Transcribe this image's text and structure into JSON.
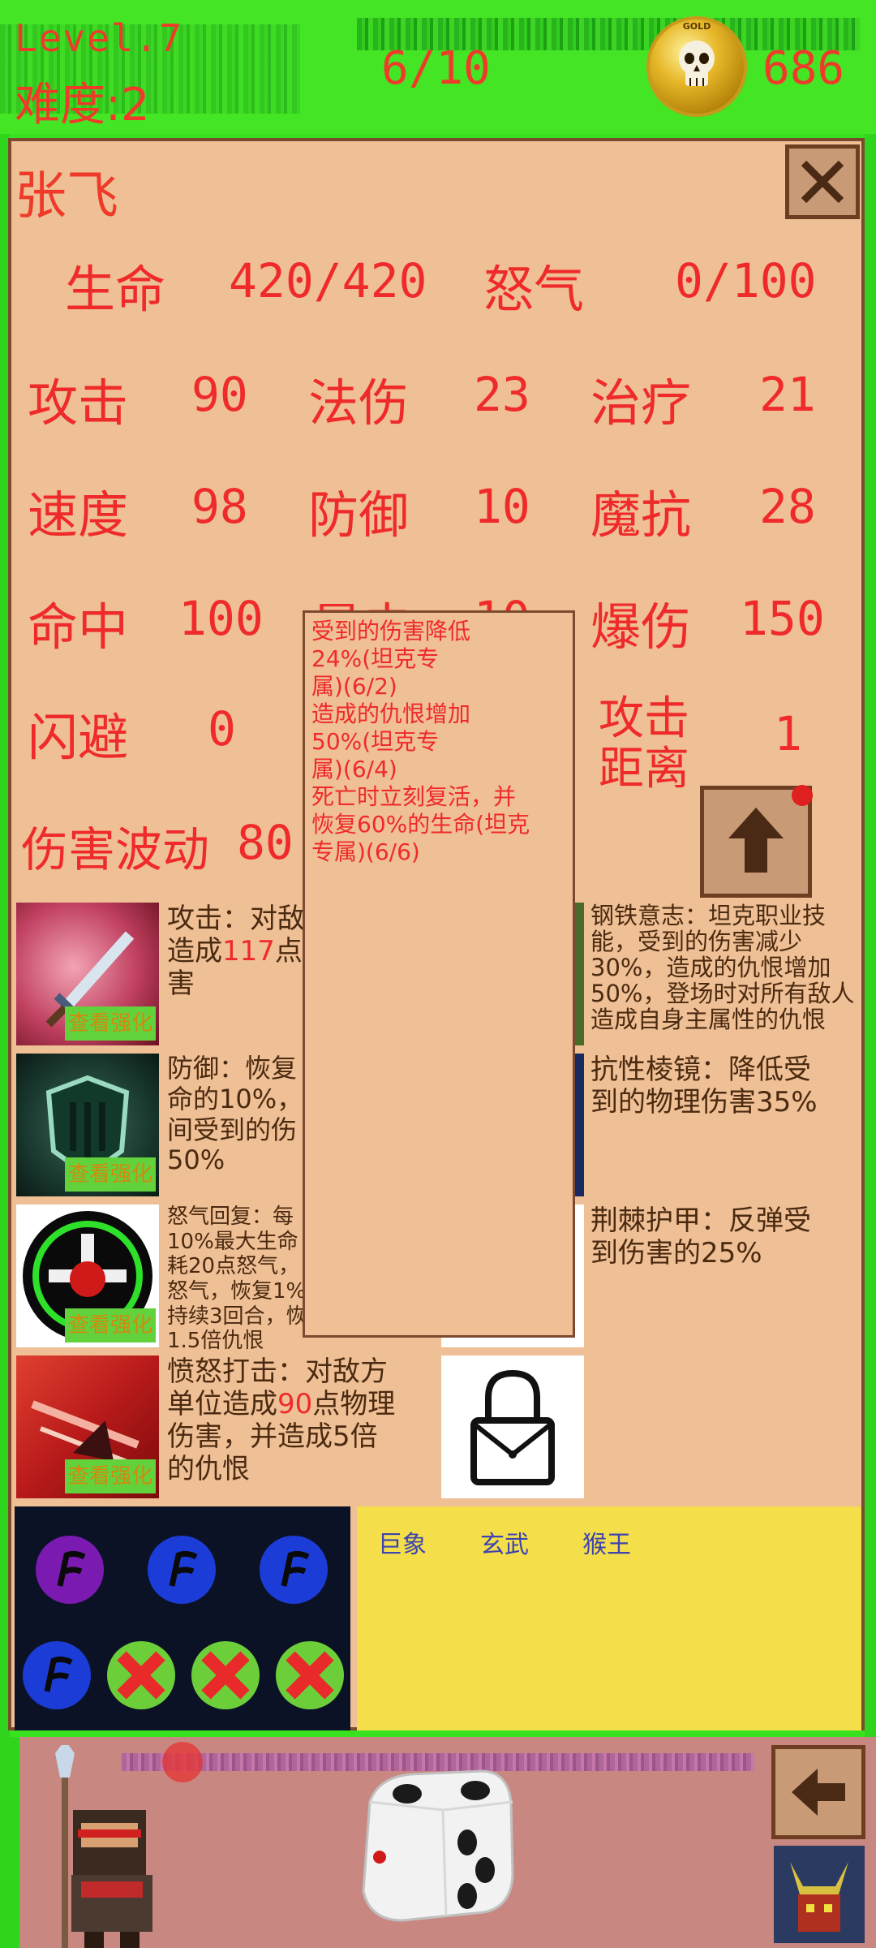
{
  "top": {
    "level": "Level.7",
    "difficulty": "难度:2",
    "progress": "6/10",
    "coin_text": "GOLD",
    "gold": "686"
  },
  "hero": {
    "name": "张飞"
  },
  "stats": {
    "hp_label": "生命",
    "hp_value": "420/420",
    "rage_label": "怒气",
    "rage_value": "0/100",
    "atk_label": "攻击",
    "atk_value": "90",
    "magic_label": "法伤",
    "magic_value": "23",
    "heal_label": "治疗",
    "heal_value": "21",
    "speed_label": "速度",
    "speed_value": "98",
    "def_label": "防御",
    "def_value": "10",
    "res_label": "魔抗",
    "res_value": "28",
    "hit_label": "命中",
    "hit_value": "100",
    "crit_label": "暴击",
    "crit_value": "10",
    "critdmg_label": "爆伤",
    "critdmg_value": "150",
    "dodge_label": "闪避",
    "dodge_value": "0",
    "range_label_1": "攻击",
    "range_label_2": "距离",
    "range_value": "1",
    "wave_label": "伤害波动",
    "wave_value": "80"
  },
  "skills": {
    "s1_a": "攻击：对敌",
    "s1_b_pre": "造成",
    "s1_b_num": "117",
    "s1_b_post": "点",
    "s1_c": "害",
    "s2_a": "防御：恢复",
    "s2_b": "命的10%，",
    "s2_c": "间受到的伤",
    "s2_d": "50%",
    "s3_a": "怒气回复：每",
    "s3_b": "10%最大生命",
    "s3_c": "耗20点怒气，",
    "s3_d": "怒气，恢复1%",
    "s3_e": "持续3回合，恢",
    "s3_f": "1.5倍仇恨",
    "s4_a": "愤怒打击：对敌方",
    "s4_b_pre": "单位造成",
    "s4_b_num": "90",
    "s4_b_post": "点物理",
    "s4_c": "伤害，并造成5倍",
    "s4_d": "的仇恨",
    "p1_a": "钢铁意志：坦克职业技",
    "p1_b": "能，受到的伤害减少",
    "p1_c": "30%，造成的仇恨增加",
    "p1_d": "50%，登场时对所有敌人",
    "p1_e": "造成自身主属性的仇恨",
    "p2_a": "抗性棱镜：降低受",
    "p2_b": "到的物理伤害35%",
    "p3_a": "荆棘护甲：反弹受",
    "p3_b": "到伤害的25%",
    "enhance": "查看强化"
  },
  "tooltip": {
    "l1": "受到的伤害降低",
    "l2": "24%(坦克专",
    "l3": "属)(6/2)",
    "l4": "造成的仇恨增加",
    "l5": "50%(坦克专",
    "l6": "属)(6/4)",
    "l7": "死亡时立刻复活，并",
    "l8": "恢复60%的生命(坦克",
    "l9": "专属)(6/6)"
  },
  "team": [
    "巨象",
    "玄武",
    "猴王"
  ],
  "colors": {
    "accent_red": "#ef2a2a",
    "panel_bg": "#efbf95",
    "frame_green": "#39e21f",
    "team_bg": "#f4df4a"
  }
}
